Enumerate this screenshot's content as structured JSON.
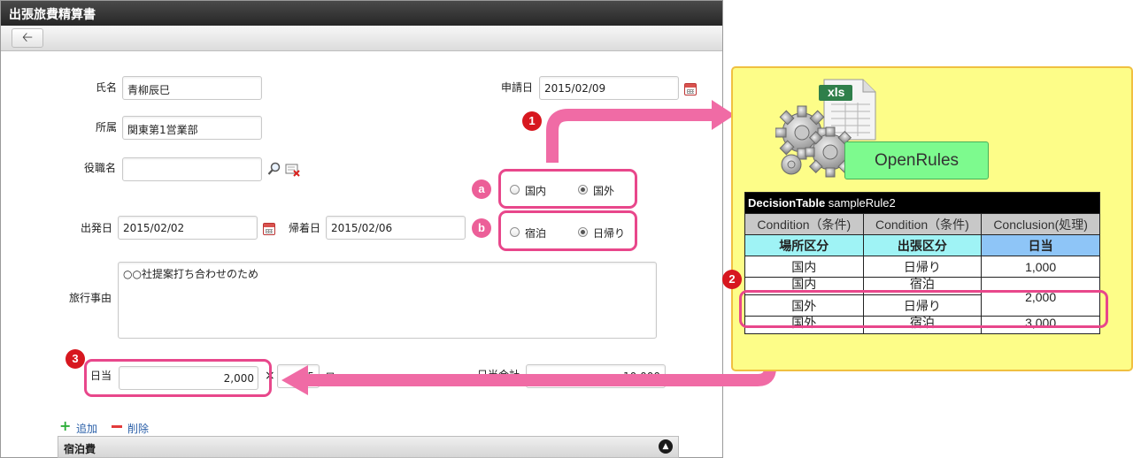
{
  "window": {
    "title": "出張旅費精算書",
    "back_icon": "arrow-left-icon"
  },
  "form": {
    "name": {
      "label": "氏名",
      "value": "青柳辰巳"
    },
    "dept": {
      "label": "所属",
      "value": "関東第1営業部"
    },
    "position": {
      "label": "役職名",
      "value": ""
    },
    "apply_date": {
      "label": "申請日",
      "value": "2015/02/09"
    },
    "region": {
      "options": [
        "国内",
        "国外"
      ],
      "selected": "国外"
    },
    "stay": {
      "options": [
        "宿泊",
        "日帰り"
      ],
      "selected": "日帰り"
    },
    "depart": {
      "label": "出発日",
      "value": "2015/02/02"
    },
    "return": {
      "label": "帰着日",
      "value": "2015/02/06"
    },
    "reason": {
      "label": "旅行事由",
      "value": "○○社提案打ち合わせのため"
    },
    "daily": {
      "label": "日当",
      "value": "2,000",
      "times": "×",
      "days_value": "5",
      "days_unit": "日"
    },
    "daily_total": {
      "label": "日当合計",
      "value": "10,000"
    },
    "add_label": "追加",
    "delete_label": "削除",
    "section_title": "宿泊費"
  },
  "annotations": {
    "badge1": "1",
    "badge2": "2",
    "badge3": "3",
    "badge_a": "a",
    "badge_b": "b"
  },
  "openrules": {
    "logo_label": "OpenRules",
    "file_badge": "xls",
    "table": {
      "title_bold": "DecisionTable",
      "title_rest": " sampleRule2",
      "headers": [
        "Condition（条件)",
        "Condition（条件)",
        "Conclusion(処理)"
      ],
      "subheaders": [
        "場所区分",
        "出張区分",
        "日当"
      ],
      "rows": [
        [
          "国内",
          "日帰り",
          "1,000"
        ],
        [
          "国内",
          "宿泊",
          "2,000"
        ],
        [
          "国外",
          "日帰り",
          ""
        ],
        [
          "国外",
          "宿泊",
          "3,000"
        ]
      ]
    }
  },
  "colors": {
    "highlight": "#e8478b",
    "arrow": "#f06ba5",
    "panel": "#fdfd88",
    "logo": "#7dfa8e"
  }
}
